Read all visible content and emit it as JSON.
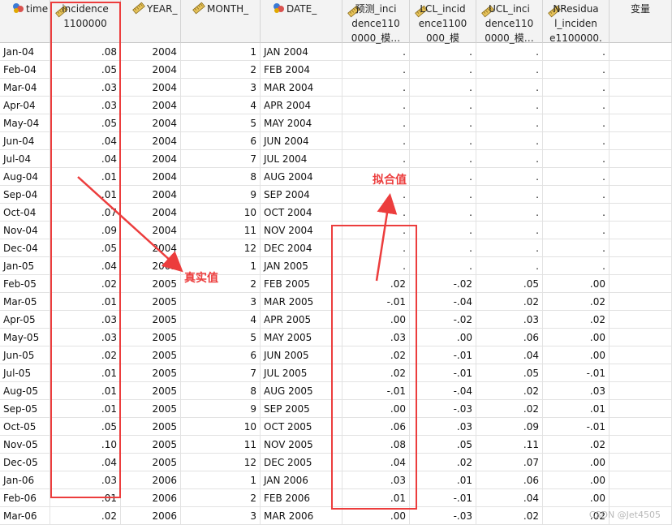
{
  "headers": [
    {
      "key": "time",
      "label": "time",
      "icon": "nominal-ball-icon",
      "align": "top"
    },
    {
      "key": "incidence",
      "label": "incidence\n1100000",
      "icon": "scale-ruler-icon",
      "align": "center"
    },
    {
      "key": "year",
      "label": "YEAR_",
      "icon": "scale-ruler-icon",
      "align": "top"
    },
    {
      "key": "month",
      "label": "MONTH_",
      "icon": "scale-ruler-icon",
      "align": "top"
    },
    {
      "key": "date",
      "label": "DATE_",
      "icon": "nominal-ball-icon",
      "align": "top"
    },
    {
      "key": "pred",
      "label": "预测_inci\ndence110\n0000_模…",
      "icon": "scale-ruler-icon",
      "align": "center"
    },
    {
      "key": "lcl",
      "label": "LCL_incid\nence1100\n000_模",
      "icon": "scale-ruler-icon",
      "align": "center"
    },
    {
      "key": "ucl",
      "label": "UCL_inci\ndence110\n0000_模…",
      "icon": "scale-ruler-icon",
      "align": "center"
    },
    {
      "key": "nres",
      "label": "NResidua\nl_inciden\ne1100000.",
      "icon": "scale-ruler-icon",
      "align": "center"
    },
    {
      "key": "var",
      "label": "变量",
      "icon": "",
      "align": "center"
    }
  ],
  "rows": [
    [
      "Jan-04",
      ".08",
      "2004",
      "1",
      "JAN 2004",
      ".",
      ".",
      ".",
      "."
    ],
    [
      "Feb-04",
      ".05",
      "2004",
      "2",
      "FEB 2004",
      ".",
      ".",
      ".",
      "."
    ],
    [
      "Mar-04",
      ".03",
      "2004",
      "3",
      "MAR 2004",
      ".",
      ".",
      ".",
      "."
    ],
    [
      "Apr-04",
      ".03",
      "2004",
      "4",
      "APR 2004",
      ".",
      ".",
      ".",
      "."
    ],
    [
      "May-04",
      ".05",
      "2004",
      "5",
      "MAY 2004",
      ".",
      ".",
      ".",
      "."
    ],
    [
      "Jun-04",
      ".04",
      "2004",
      "6",
      "JUN 2004",
      ".",
      ".",
      ".",
      "."
    ],
    [
      "Jul-04",
      ".04",
      "2004",
      "7",
      "JUL 2004",
      ".",
      ".",
      ".",
      "."
    ],
    [
      "Aug-04",
      ".01",
      "2004",
      "8",
      "AUG 2004",
      ".",
      ".",
      ".",
      "."
    ],
    [
      "Sep-04",
      ".01",
      "2004",
      "9",
      "SEP 2004",
      ".",
      ".",
      ".",
      "."
    ],
    [
      "Oct-04",
      ".07",
      "2004",
      "10",
      "OCT 2004",
      ".",
      ".",
      ".",
      "."
    ],
    [
      "Nov-04",
      ".09",
      "2004",
      "11",
      "NOV 2004",
      ".",
      ".",
      ".",
      "."
    ],
    [
      "Dec-04",
      ".05",
      "2004",
      "12",
      "DEC 2004",
      ".",
      ".",
      ".",
      "."
    ],
    [
      "Jan-05",
      ".04",
      "2005",
      "1",
      "JAN 2005",
      ".",
      ".",
      ".",
      "."
    ],
    [
      "Feb-05",
      ".02",
      "2005",
      "2",
      "FEB 2005",
      ".02",
      "-.02",
      ".05",
      ".00"
    ],
    [
      "Mar-05",
      ".01",
      "2005",
      "3",
      "MAR 2005",
      "-.01",
      "-.04",
      ".02",
      ".02"
    ],
    [
      "Apr-05",
      ".03",
      "2005",
      "4",
      "APR 2005",
      ".00",
      "-.02",
      ".03",
      ".02"
    ],
    [
      "May-05",
      ".03",
      "2005",
      "5",
      "MAY 2005",
      ".03",
      ".00",
      ".06",
      ".00"
    ],
    [
      "Jun-05",
      ".02",
      "2005",
      "6",
      "JUN 2005",
      ".02",
      "-.01",
      ".04",
      ".00"
    ],
    [
      "Jul-05",
      ".01",
      "2005",
      "7",
      "JUL 2005",
      ".02",
      "-.01",
      ".05",
      "-.01"
    ],
    [
      "Aug-05",
      ".01",
      "2005",
      "8",
      "AUG 2005",
      "-.01",
      "-.04",
      ".02",
      ".03"
    ],
    [
      "Sep-05",
      ".01",
      "2005",
      "9",
      "SEP 2005",
      ".00",
      "-.03",
      ".02",
      ".01"
    ],
    [
      "Oct-05",
      ".05",
      "2005",
      "10",
      "OCT 2005",
      ".06",
      ".03",
      ".09",
      "-.01"
    ],
    [
      "Nov-05",
      ".10",
      "2005",
      "11",
      "NOV 2005",
      ".08",
      ".05",
      ".11",
      ".02"
    ],
    [
      "Dec-05",
      ".04",
      "2005",
      "12",
      "DEC 2005",
      ".04",
      ".02",
      ".07",
      ".00"
    ],
    [
      "Jan-06",
      ".03",
      "2006",
      "1",
      "JAN 2006",
      ".03",
      ".01",
      ".06",
      ".00"
    ],
    [
      "Feb-06",
      ".01",
      "2006",
      "2",
      "FEB 2006",
      ".01",
      "-.01",
      ".04",
      ".00"
    ],
    [
      "Mar-06",
      ".02",
      "2006",
      "3",
      "MAR 2006",
      ".00",
      "-.03",
      ".02",
      ".02"
    ]
  ],
  "annotations": {
    "true_value": "真实值",
    "fitted_value": "拟合值"
  },
  "watermark": "CSDN @Jet4505",
  "colors": {
    "annotation": "#ec3d3d",
    "header_bg": "#f3f3f3",
    "grid": "#e2e2e2"
  }
}
